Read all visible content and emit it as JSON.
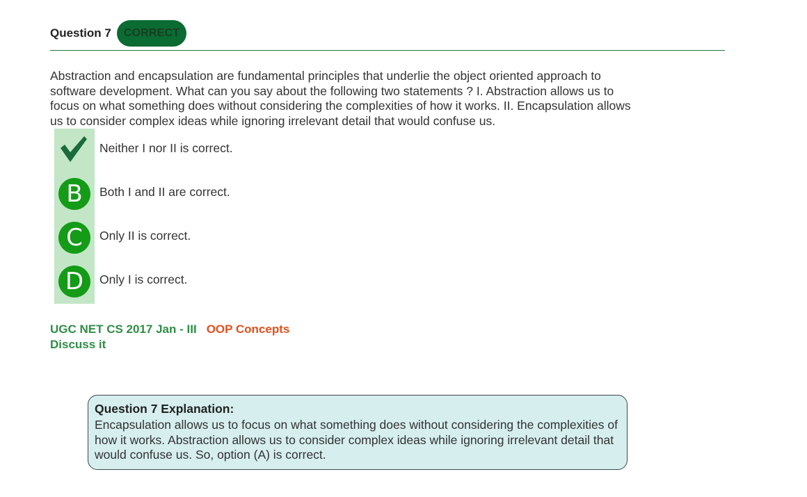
{
  "question": {
    "title": "Question 7",
    "status": "CORRECT",
    "text": "Abstraction and encapsulation are fundamental principles that underlie the object oriented approach to software development. What can you say about the following two statements ? I. Abstraction allows us to focus on what something does without considering the complexities of how it works. II. Encapsulation allows us to consider complex ideas while ignoring irrelevant detail that would confuse us."
  },
  "options": [
    {
      "marker": "A",
      "marker_icon": "check-mark-icon",
      "text": "Neither I nor II is correct.",
      "selected": true,
      "correct": true
    },
    {
      "marker": "B",
      "text": "Both I and II are correct."
    },
    {
      "marker": "C",
      "text": "Only II is correct."
    },
    {
      "marker": "D",
      "text": "Only I is correct."
    }
  ],
  "tags": {
    "exam": "UGC NET CS 2017 Jan - III",
    "topic": "OOP Concepts",
    "discuss": "Discuss it"
  },
  "explanation": {
    "title": "Question 7 Explanation:",
    "text": "Encapsulation allows us to focus on what something does without considering the complexities of how it works. Abstraction allows us to consider complex ideas while ignoring irrelevant detail that would confuse us. So, option (A) is correct."
  },
  "colors": {
    "badge_bg": "#0a6b33",
    "marker_green": "#149b17",
    "strip_green": "#c2e6c6",
    "check_green": "#1a6b3a",
    "tag_green": "#2f8d46",
    "tag_orange": "#e0511e",
    "explanation_bg": "#d6eeee"
  }
}
